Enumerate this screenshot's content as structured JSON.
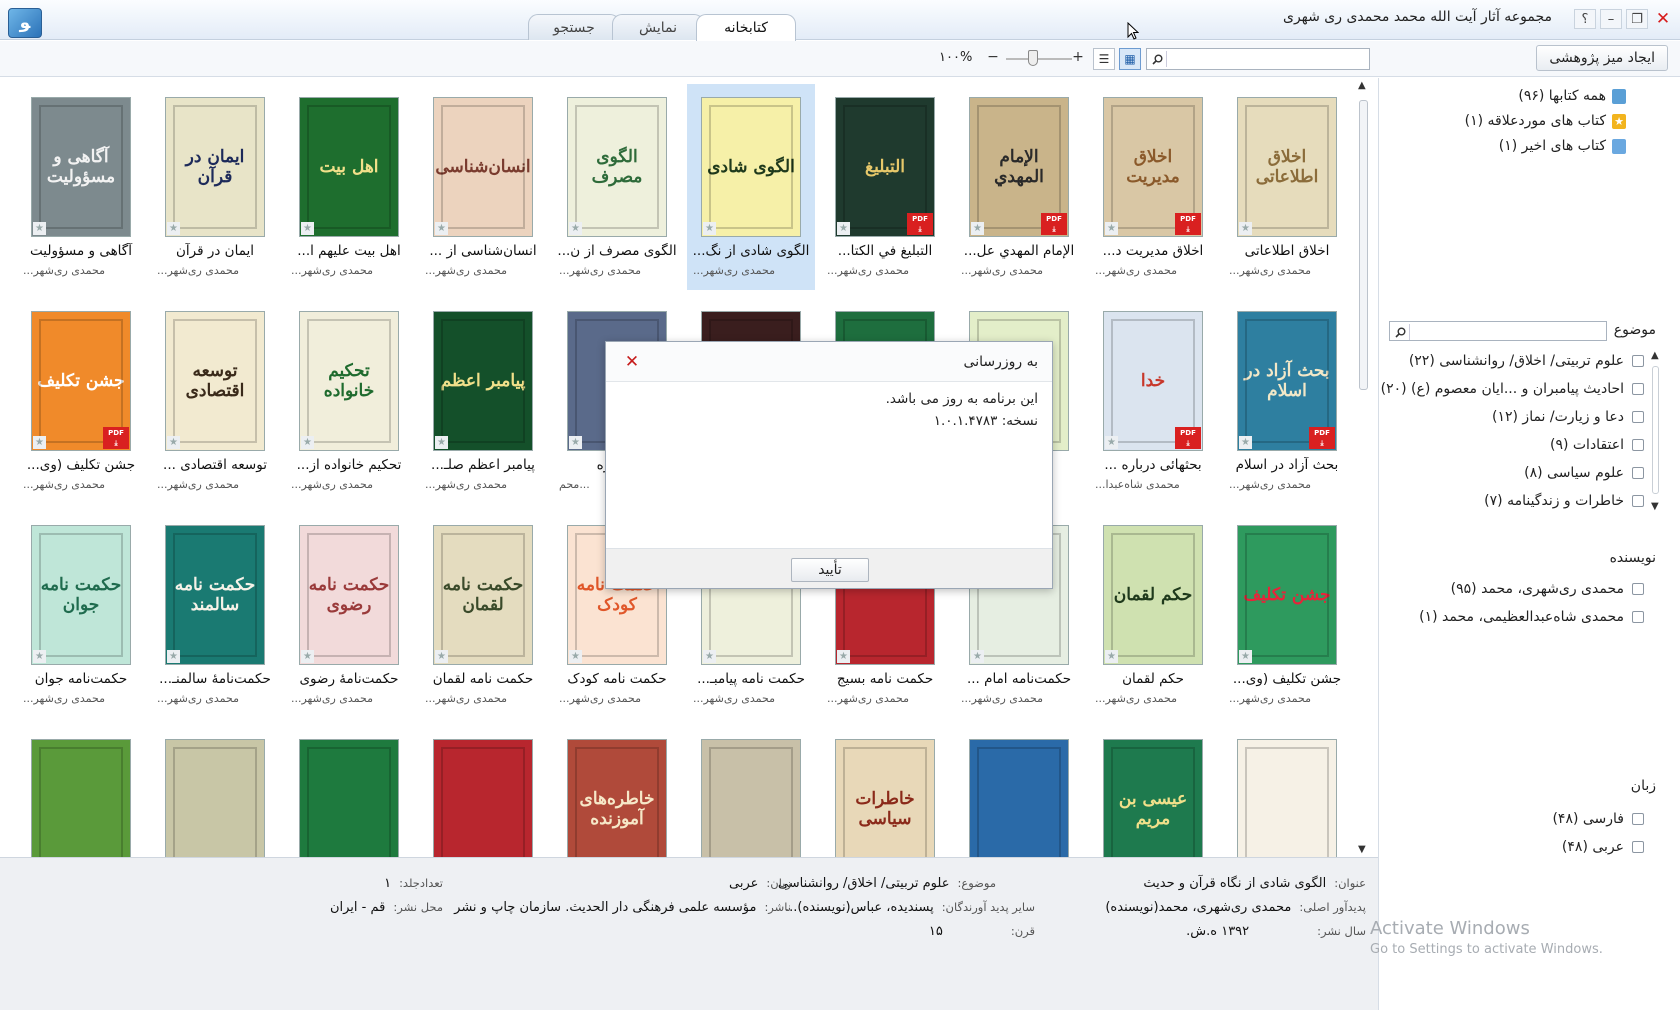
{
  "window": {
    "title": "مجموعه آثار آیت الله محمد محمدی ری شهری",
    "logo": "ﻮ",
    "help": "؟",
    "min": "–",
    "max": "❐",
    "close": "✕"
  },
  "tabs": [
    {
      "label": "کتابخانه",
      "active": true
    },
    {
      "label": "نمایش",
      "active": false
    },
    {
      "label": "جستجو",
      "active": false
    }
  ],
  "toolbar": {
    "create_label": "ایجاد میز پژوهشی",
    "search_placeholder": "",
    "zoom": "۱۰۰%",
    "zoom_minus": "−",
    "zoom_plus": "+",
    "view_list": "☰",
    "view_grid": "▦"
  },
  "books": [
    {
      "title": "اخلاق اطلاعاتی",
      "author": "محمدی ری‌شهر...",
      "cover_text": "اخلاق اطلاعاتی",
      "bg": "#e6dcbc",
      "fg": "#8b6c3a",
      "pdf": false
    },
    {
      "title": "اخلاق مدیریت د...",
      "author": "محمدی ری‌شهر...",
      "cover_text": "اخلاق مدیریت",
      "bg": "#d9c7a5",
      "fg": "#8b5a2b",
      "pdf": true
    },
    {
      "title": "الإمام المهدي عل...",
      "author": "محمدی ری‌شهر...",
      "cover_text": "الإمام المهدي",
      "bg": "#c9b48a",
      "fg": "#2a2a2a",
      "pdf": true
    },
    {
      "title": "التبليغ في الكتا...",
      "author": "محمدی ری‌شهر...",
      "cover_text": "التبليغ",
      "bg": "#1f3a2e",
      "fg": "#e7c86a",
      "pdf": true
    },
    {
      "title": "الگوی شادی از نگ...",
      "author": "محمدی ری‌شهر...",
      "cover_text": "الگوی شادی",
      "bg": "#f6f0a8",
      "fg": "#1f3a1c",
      "pdf": false,
      "selected": true
    },
    {
      "title": "الگوی مصرف از ن...",
      "author": "محمدی ری‌شهر...",
      "cover_text": "الگوی مصرف",
      "bg": "#eef0dc",
      "fg": "#2e6b3a",
      "pdf": false
    },
    {
      "title": "انسان‌شناسی از ...",
      "author": "محمدی ری‌شهر...",
      "cover_text": "انسان‌شناسی",
      "bg": "#ecd3be",
      "fg": "#7a3b2e",
      "pdf": false
    },
    {
      "title": "اهل بیت علیهم ا...",
      "author": "محمدی ری‌شهر...",
      "cover_text": "اهل بیت",
      "bg": "#1e6e2e",
      "fg": "#f1e08a",
      "pdf": false
    },
    {
      "title": "ایمان در قرآن",
      "author": "محمدی ری‌شهر...",
      "cover_text": "ایمان در قرآن",
      "bg": "#e8e4c8",
      "fg": "#1d2a5a",
      "pdf": false
    },
    {
      "title": "آگاهی و مسؤولیت",
      "author": "محمدی ری‌شهر...",
      "cover_text": "آگاهی و مسؤولیت",
      "bg": "#7d8a8e",
      "fg": "#f2f2f2",
      "pdf": false
    },
    {
      "title": "بحث آزاد در اسلام",
      "author": "محمدی ری‌شهر...",
      "cover_text": "بحث آزاد در اسلام",
      "bg": "#2e7fa0",
      "fg": "#f2e8c8",
      "pdf": true
    },
    {
      "title": "بحثهائی درباره ...",
      "author": "محمدی شاه‌عبدا...",
      "cover_text": "خدا",
      "bg": "#dbe4ef",
      "fg": "#c8372a",
      "pdf": true
    },
    {
      "title": "بر...",
      "author": "...",
      "cover_text": "",
      "bg": "#e3eec9",
      "fg": "#556b2f",
      "pdf": false
    },
    {
      "title": "",
      "author": "",
      "cover_text": "",
      "bg": "#1e6e3e",
      "fg": "#f1e08a",
      "pdf": false
    },
    {
      "title": "",
      "author": "",
      "cover_text": "",
      "bg": "#3a1e1e",
      "fg": "#e0b060",
      "pdf": false
    },
    {
      "title": "...رباره",
      "author": "...محم",
      "cover_text": "",
      "bg": "#5a6a8a",
      "fg": "#fff",
      "pdf": false
    },
    {
      "title": "پیامبر اعظم صلـ...",
      "author": "محمدی ری‌شهر...",
      "cover_text": "پیامبر اعظم",
      "bg": "#14502a",
      "fg": "#f1e08a",
      "pdf": false
    },
    {
      "title": "تحکیم خانواده از...",
      "author": "محمدی ری‌شهر...",
      "cover_text": "تحکیم خانواده",
      "bg": "#f1eedb",
      "fg": "#1f6b2e",
      "pdf": false
    },
    {
      "title": "توسعه اقتصادی ...",
      "author": "محمدی ری‌شهر...",
      "cover_text": "توسعه اقتصادی",
      "bg": "#f2ead0",
      "fg": "#3a2a1a",
      "pdf": false
    },
    {
      "title": "جشن تکلیف (وی...",
      "author": "محمدی ری‌شهر...",
      "cover_text": "جشن تکلیف",
      "bg": "#f08a2a",
      "fg": "#fff",
      "pdf": true
    },
    {
      "title": "جشن تکلیف (وی...",
      "author": "محمدی ری‌شهر...",
      "cover_text": "جشن تکلیف",
      "bg": "#2e9a5e",
      "fg": "#e8233a",
      "pdf": false
    },
    {
      "title": "حکم لقمان",
      "author": "محمدی ری‌شهر...",
      "cover_text": "حکم لقمان",
      "bg": "#cfe1b0",
      "fg": "#1f3a1c",
      "pdf": false
    },
    {
      "title": "حکمت‌نامه امام ...",
      "author": "محمدی ری‌شهر...",
      "cover_text": "",
      "bg": "#e6eee2",
      "fg": "#2e6b3a",
      "pdf": false
    },
    {
      "title": "حکمت نامه بسیج",
      "author": "محمدی ری‌شهر...",
      "cover_text": "",
      "bg": "#b8262e",
      "fg": "#f1e08a",
      "pdf": false
    },
    {
      "title": "حکمت نامه پیامبـ...",
      "author": "محمدی ری‌شهر...",
      "cover_text": "",
      "bg": "#eef0dc",
      "fg": "#1f6b2e",
      "pdf": false
    },
    {
      "title": "حکمت نامه کودک",
      "author": "محمدی ری‌شهر...",
      "cover_text": "حکمت نامه کودک",
      "bg": "#fbe3d2",
      "fg": "#e0572a",
      "pdf": false
    },
    {
      "title": "حکمت نامه لقمان",
      "author": "محمدی ری‌شهر...",
      "cover_text": "حکمت نامه لقمان",
      "bg": "#e4dcbf",
      "fg": "#3a4a2a",
      "pdf": false
    },
    {
      "title": "حکمت‌نامهٔ رضوی",
      "author": "محمدی ری‌شهر...",
      "cover_text": "حکمت نامه رضوی",
      "bg": "#f2dada",
      "fg": "#9a3a3a",
      "pdf": false
    },
    {
      "title": "حکمت‌نامهٔ سالمنـ...",
      "author": "محمدی ری‌شهر...",
      "cover_text": "حکمت نامه سالمند",
      "bg": "#1a7a72",
      "fg": "#f6f2e8",
      "pdf": false
    },
    {
      "title": "حکمت‌نامه جوان",
      "author": "محمدی ری‌شهر...",
      "cover_text": "حکمت نامه جوان",
      "bg": "#bfe6d8",
      "fg": "#1f6b4e",
      "pdf": false
    },
    {
      "title": "",
      "author": "",
      "cover_text": "",
      "bg": "#f6f1e6",
      "fg": "#7a3b2e",
      "pdf": false
    },
    {
      "title": "",
      "author": "",
      "cover_text": "عیسی بن مریم",
      "bg": "#1e7a4e",
      "fg": "#f1e08a",
      "pdf": false
    },
    {
      "title": "",
      "author": "",
      "cover_text": "",
      "bg": "#2a6aa8",
      "fg": "#fff",
      "pdf": false
    },
    {
      "title": "",
      "author": "",
      "cover_text": "خاطرات سیاسی",
      "bg": "#e8d8b8",
      "fg": "#8b2a1a",
      "pdf": false
    },
    {
      "title": "",
      "author": "",
      "cover_text": "",
      "bg": "#c8c0a8",
      "fg": "#2a2a2a",
      "pdf": false
    },
    {
      "title": "",
      "author": "",
      "cover_text": "خاطره‌های آموزنده",
      "bg": "#b04a3a",
      "fg": "#f6e8c8",
      "pdf": false
    },
    {
      "title": "",
      "author": "",
      "cover_text": "",
      "bg": "#b8262e",
      "fg": "#f1e08a",
      "pdf": false
    },
    {
      "title": "",
      "author": "",
      "cover_text": "",
      "bg": "#1e7a3e",
      "fg": "#f1e08a",
      "pdf": false
    },
    {
      "title": "",
      "author": "",
      "cover_text": "",
      "bg": "#c8c6a6",
      "fg": "#3a3a2a",
      "pdf": false
    },
    {
      "title": "",
      "author": "",
      "cover_text": "",
      "bg": "#5a9a3a",
      "fg": "#1f3a8a",
      "pdf": false
    }
  ],
  "sidebar": {
    "items": [
      {
        "label": "همه کتابها (۹۶)",
        "color": "#5a9fd6"
      },
      {
        "label": "کتاب های موردعلاقه (۱)",
        "color": "#f2b41e"
      },
      {
        "label": "کتاب های اخیر (۱)",
        "color": "#6aa8e0"
      }
    ],
    "facets": {
      "subject": {
        "title": "موضوع",
        "items": [
          "علوم تربیتی/ اخلاق/ روانشناسی (۲۲)",
          "احادیث پیامبران و ...ایان معصوم (ع) (۲۰)",
          "دعا و زیارت/ نماز (۱۲)",
          "اعتقادات (۹)",
          "علوم سیاسی (۸)",
          "خاطرات و زندگینامه (۷)"
        ]
      },
      "author": {
        "title": "نویسنده",
        "items": [
          "محمدی ری‌شهری، محمد (۹۵)",
          "محمدی شاه‌عبدالعظیمی، محمد (۱)"
        ]
      },
      "language": {
        "title": "زبان",
        "items": [
          "فارسی (۴۸)",
          "عربی (۴۸)"
        ]
      }
    }
  },
  "details": {
    "title_k": "عنوان:",
    "title_v": "الگوی شادی از نگاه قرآن و حدیث",
    "subject_k": "موضوع:",
    "subject_v": "علوم تربیتی/ اخلاق/ روانشناسی",
    "lang_k": "زبان:",
    "lang_v": "عربی",
    "vol_k": "تعدادجلد:",
    "vol_v": "۱",
    "creator_k": "پدیدآور اصلی:",
    "creator_v": "محمدی ری‌شهری، محمد(نویسنده)",
    "others_k": "سایر پدید آورندگان:",
    "others_v": "پسندیده، عباس(نویسنده)...",
    "publisher_k": "ناشر:",
    "publisher_v": "مؤسسه علمی فرهنگی دار الحديث. سازمان چاپ و نشر",
    "place_k": "محل نشر:",
    "place_v": "قم - ایران",
    "year_k": "سال نشر:",
    "year_v": "۱۳۹۲ ه.ش.",
    "century_k": "قرن:",
    "century_v": "۱۵"
  },
  "watermark": {
    "line1": "Activate Windows",
    "line2": "Go to Settings to activate Windows."
  },
  "dialog": {
    "title": "به روزرسانی",
    "message": "این برنامه به روز می باشد.",
    "version": "نسخه: ۱.۰.۱.۴۷۸۳",
    "ok": "تأیید",
    "close": "✕"
  }
}
